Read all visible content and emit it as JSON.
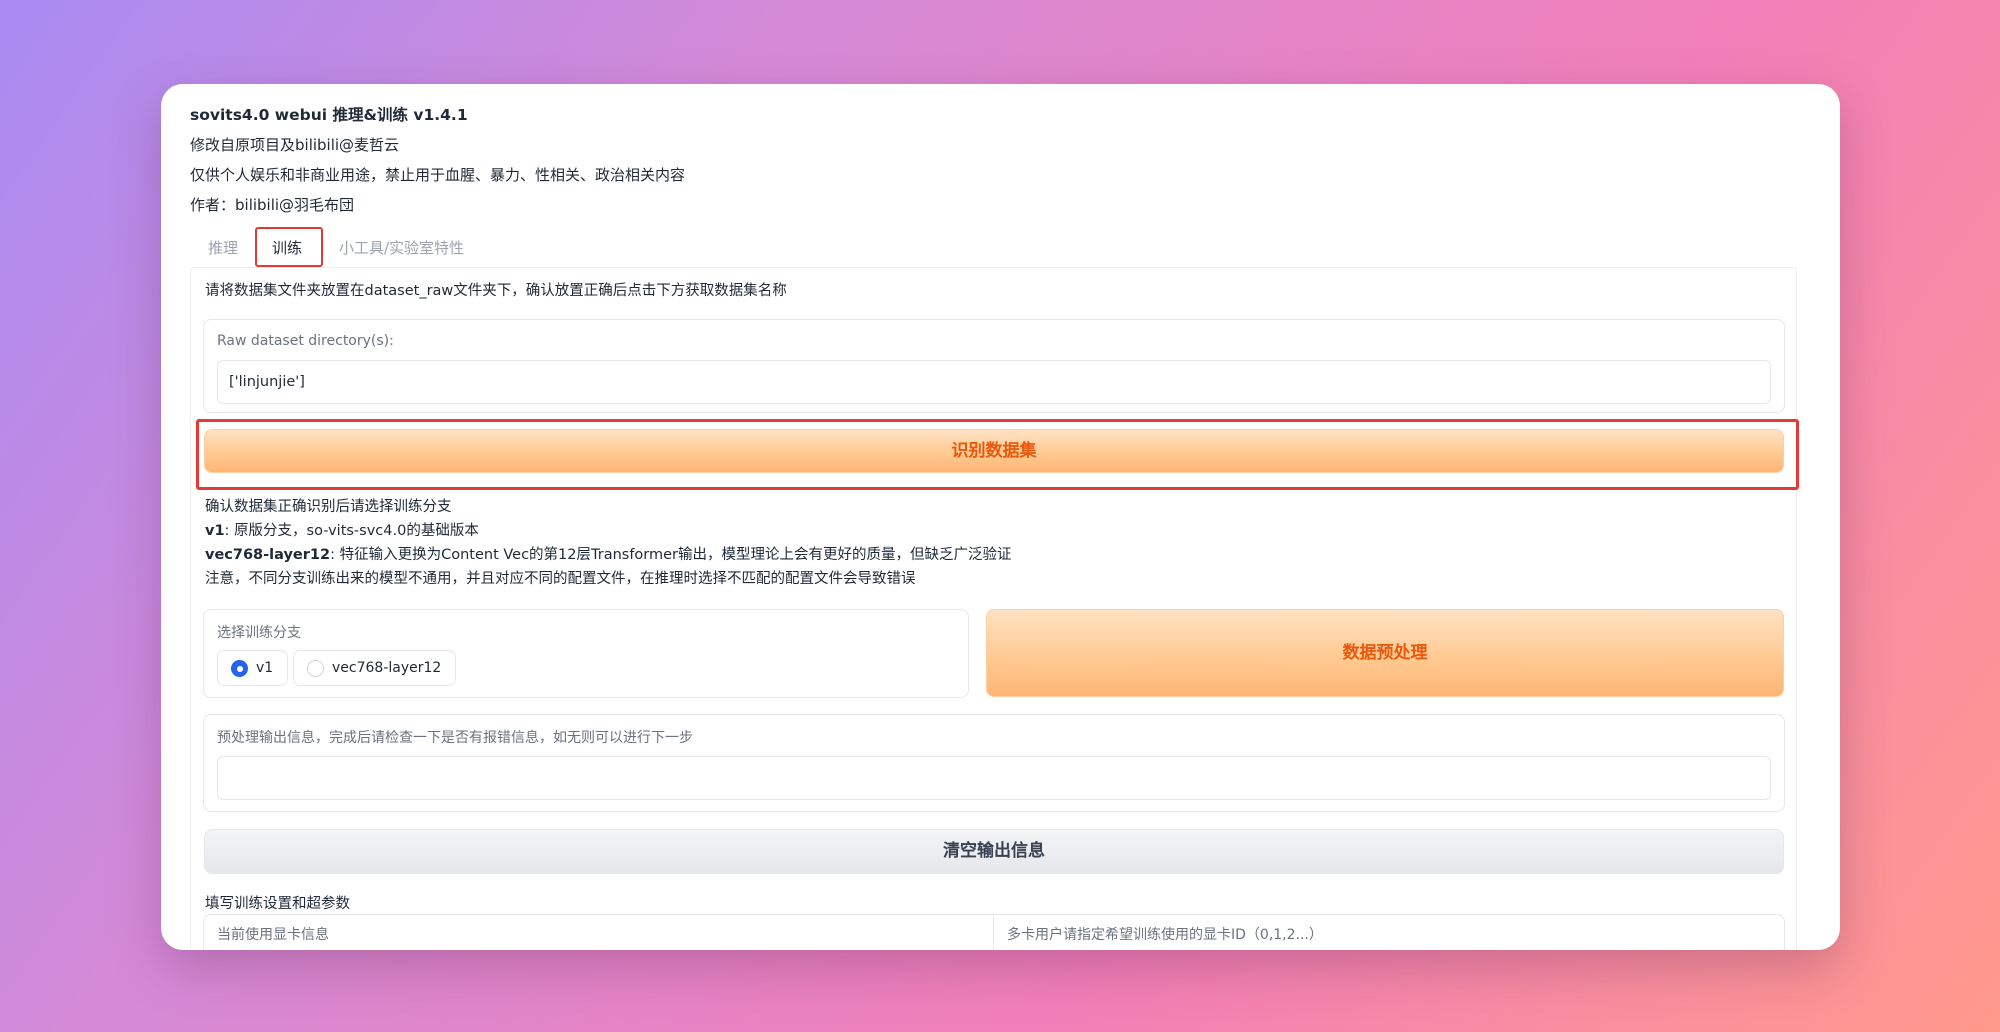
{
  "header": {
    "title": "sovits4.0 webui 推理&训练 v1.4.1",
    "line1": "修改自原项目及bilibili@麦哲云",
    "line2": "仅供个人娱乐和非商业用途，禁止用于血腥、暴力、性相关、政治相关内容",
    "author": "作者：bilibili@羽毛布団"
  },
  "tabs": [
    "推理",
    "训练",
    "小工具/实验室特性"
  ],
  "active_tab": "训练",
  "train": {
    "intro": "请将数据集文件夹放置在dataset_raw文件夹下，确认放置正确后点击下方获取数据集名称",
    "raw_dataset_label": "Raw dataset directory(s):",
    "raw_dataset_value": "['linjunjie']",
    "identify_button": "识别数据集",
    "branch_note_title": "确认数据集正确识别后请选择训练分支",
    "branch_v1_name": "v1",
    "branch_v1_desc": ": 原版分支，so-vits-svc4.0的基础版本",
    "branch_vec_name": "vec768-layer12",
    "branch_vec_desc": ": 特征输入更换为Content Vec的第12层Transformer输出，模型理论上会有更好的质量，但缺乏广泛验证",
    "branch_warning": "注意，不同分支训练出来的模型不通用，并且对应不同的配置文件，在推理时选择不匹配的配置文件会导致错误",
    "branch_select_label": "选择训练分支",
    "branch_options": [
      "v1",
      "vec768-layer12"
    ],
    "branch_selected": "v1",
    "preprocess_button": "数据预处理",
    "preprocess_output_label": "预处理输出信息，完成后请检查一下是否有报错信息，如无则可以进行下一步",
    "preprocess_output_value": "",
    "clear_output_button": "清空输出信息",
    "settings_title": "填写训练设置和超参数",
    "gpu_info_label": "当前使用显卡信息",
    "gpu_id_label": "多卡用户请指定希望训练使用的显卡ID（0,1,2...）"
  },
  "colors": {
    "accent_orange": "#ea580c",
    "highlight_red": "#e53935",
    "radio_blue": "#2563eb"
  }
}
